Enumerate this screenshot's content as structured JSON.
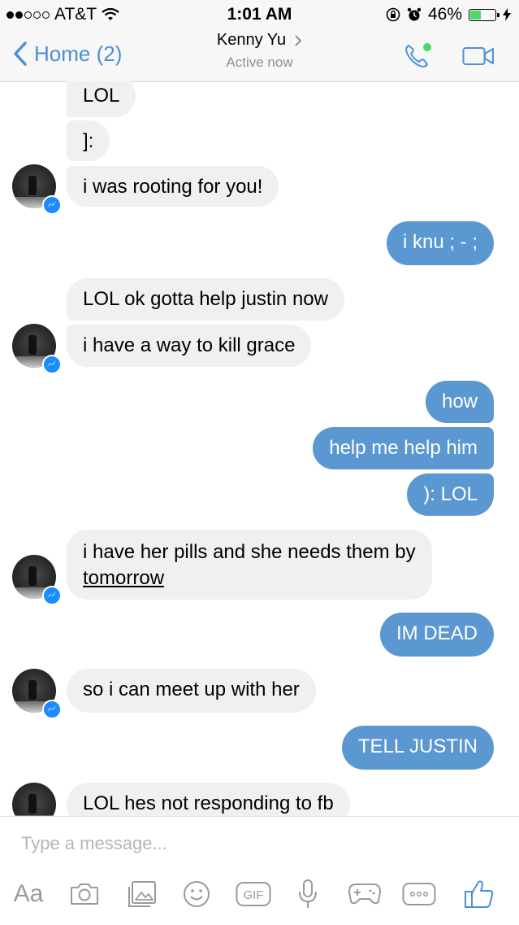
{
  "status_bar": {
    "carrier": "AT&T",
    "time": "1:01 AM",
    "battery_percent": "46%",
    "battery_level": 0.46,
    "signal_bars_filled": 2,
    "signal_bars_total": 5
  },
  "header": {
    "back_label": "Home (2)",
    "contact_name": "Kenny Yu",
    "presence": "Active now"
  },
  "messages": [
    {
      "from": "them",
      "text": "LOL"
    },
    {
      "from": "them",
      "text": "]:"
    },
    {
      "from": "them",
      "text": "i was rooting for you!"
    },
    {
      "from": "me",
      "text": "i knu ; - ;"
    },
    {
      "from": "them",
      "text": "LOL ok gotta help justin now"
    },
    {
      "from": "them",
      "text": "i have a way to kill grace"
    },
    {
      "from": "me",
      "text": "how"
    },
    {
      "from": "me",
      "text": "help me help him"
    },
    {
      "from": "me",
      "text": "): LOL"
    },
    {
      "from": "them",
      "text_line1": "i have her pills and she needs them by",
      "text_line2": "tomorrow"
    },
    {
      "from": "me",
      "text": "IM DEAD"
    },
    {
      "from": "them",
      "text": "so i can meet up with her"
    },
    {
      "from": "me",
      "text": "TELL JUSTIN"
    },
    {
      "from": "them",
      "text": "LOL hes not responding to fb"
    }
  ],
  "composer": {
    "placeholder": "Type a message...",
    "aa_label": "Aa",
    "gif_label": "GIF"
  },
  "colors": {
    "accent": "#4a90d9",
    "outgoing_bubble": "#5b97d1",
    "incoming_bubble": "#f1f0f0",
    "online_dot": "#4cd964",
    "messenger_badge": "#1a8cff",
    "toolbar_icon": "#9a9a9a"
  },
  "icons": {
    "call": "phone-icon",
    "video": "video-camera-icon",
    "camera": "camera-icon",
    "gallery": "photo-gallery-icon",
    "emoji": "smiley-icon",
    "gif": "gif-icon",
    "mic": "microphone-icon",
    "games": "gamepad-icon",
    "more": "more-icon",
    "like": "thumbs-up-icon"
  }
}
